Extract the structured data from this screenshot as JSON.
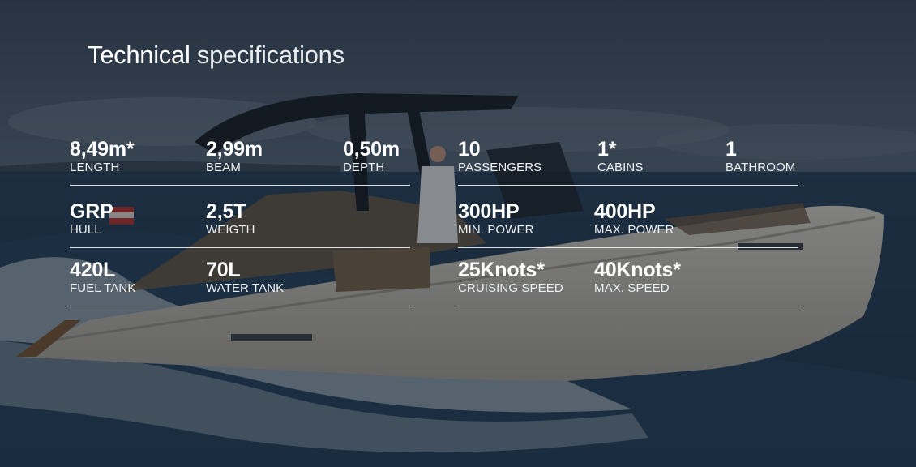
{
  "heading": {
    "strong": "Technical",
    "light": "specifications"
  },
  "specs": {
    "length": {
      "value": "8,49m*",
      "label": "LENGTH"
    },
    "beam": {
      "value": "2,99m",
      "label": "BEAM"
    },
    "depth": {
      "value": "0,50m",
      "label": "DEPTH"
    },
    "passengers": {
      "value": "10",
      "label": "PASSENGERS"
    },
    "cabins": {
      "value": "1*",
      "label": "CABINS"
    },
    "bathroom": {
      "value": "1",
      "label": "BATHROOM"
    },
    "hull": {
      "value": "GRP",
      "label": "HULL"
    },
    "weigth": {
      "value": "2,5T",
      "label": "WEIGTH"
    },
    "min_power": {
      "value": "300HP",
      "label": "MIN. POWER"
    },
    "max_power": {
      "value": "400HP",
      "label": "MAX. POWER"
    },
    "fuel_tank": {
      "value": "420L",
      "label": "FUEL TANK"
    },
    "water_tank": {
      "value": "70L",
      "label": "WATER TANK"
    },
    "cruising_speed": {
      "value": "25Knots*",
      "label": "CRUISING SPEED"
    },
    "max_speed": {
      "value": "40Knots*",
      "label": "MAX. SPEED"
    }
  },
  "colors": {
    "overlay": "#121821",
    "text": "#ffffff",
    "hull": "#d9d4c8",
    "sea": "#1f3a56"
  }
}
